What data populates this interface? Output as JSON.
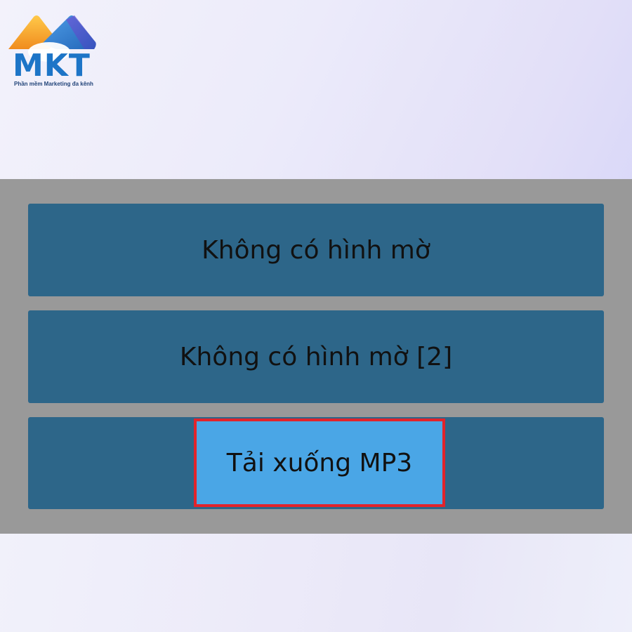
{
  "logo": {
    "text": "MKT",
    "tagline": "Phần mềm Marketing đa kênh"
  },
  "menu": {
    "items": [
      {
        "label": "Không có hình mờ"
      },
      {
        "label": "Không có hình mờ [2]"
      },
      {
        "label": "Tải xuống MP3",
        "highlighted": true
      }
    ]
  },
  "colors": {
    "panel_bg": "#999999",
    "item_bg": "#2d6689",
    "highlight_bg": "#4aa6e6",
    "highlight_border": "#e2232b",
    "logo_blue": "#1d75c7",
    "logo_orange": "#f5a623"
  }
}
